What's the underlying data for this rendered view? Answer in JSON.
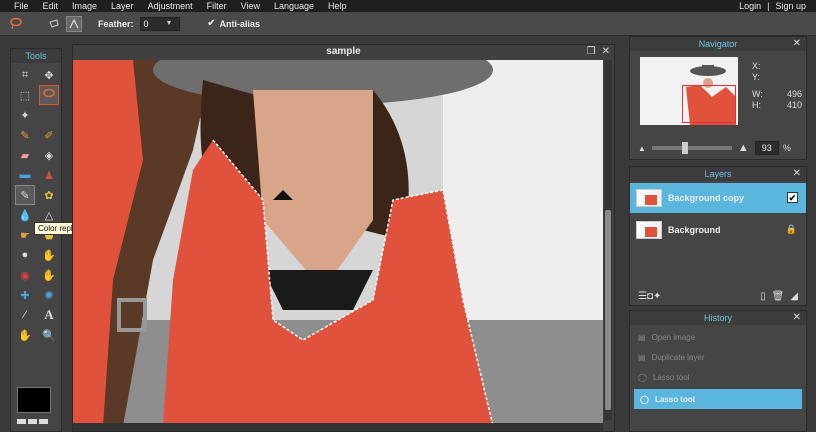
{
  "menu": {
    "items": [
      "File",
      "Edit",
      "Image",
      "Layer",
      "Adjustment",
      "Filter",
      "View",
      "Language",
      "Help"
    ],
    "login": "Login",
    "separator": "|",
    "signup": "Sign up"
  },
  "options": {
    "feather_label": "Feather:",
    "feather_value": "0",
    "antialias_label": "Anti-alias",
    "antialias_checked": true
  },
  "tools": {
    "title": "Tools",
    "tooltip": "Color replace tool",
    "active": "lasso-tool",
    "foreground_color": "#000000"
  },
  "document": {
    "title": "sample"
  },
  "navigator": {
    "title": "Navigator",
    "x_label": "X:",
    "y_label": "Y:",
    "w_label": "W:",
    "w_value": "496",
    "h_label": "H:",
    "h_value": "410",
    "zoom_value": "93",
    "zoom_unit": "%"
  },
  "layers": {
    "title": "Layers",
    "items": [
      {
        "name": "Background copy",
        "active": true,
        "visible": true
      },
      {
        "name": "Background",
        "active": false,
        "locked": true
      }
    ]
  },
  "history": {
    "title": "History",
    "items": [
      {
        "name": "Open image",
        "active": false
      },
      {
        "name": "Duplicate layer",
        "active": false
      },
      {
        "name": "Lasso tool",
        "active": false
      },
      {
        "name": "Lasso tool",
        "active": true
      }
    ]
  },
  "colors": {
    "accent": "#5ab6dd",
    "selected_tool_border": "#d85a2b",
    "shirt": "#e0523c"
  }
}
